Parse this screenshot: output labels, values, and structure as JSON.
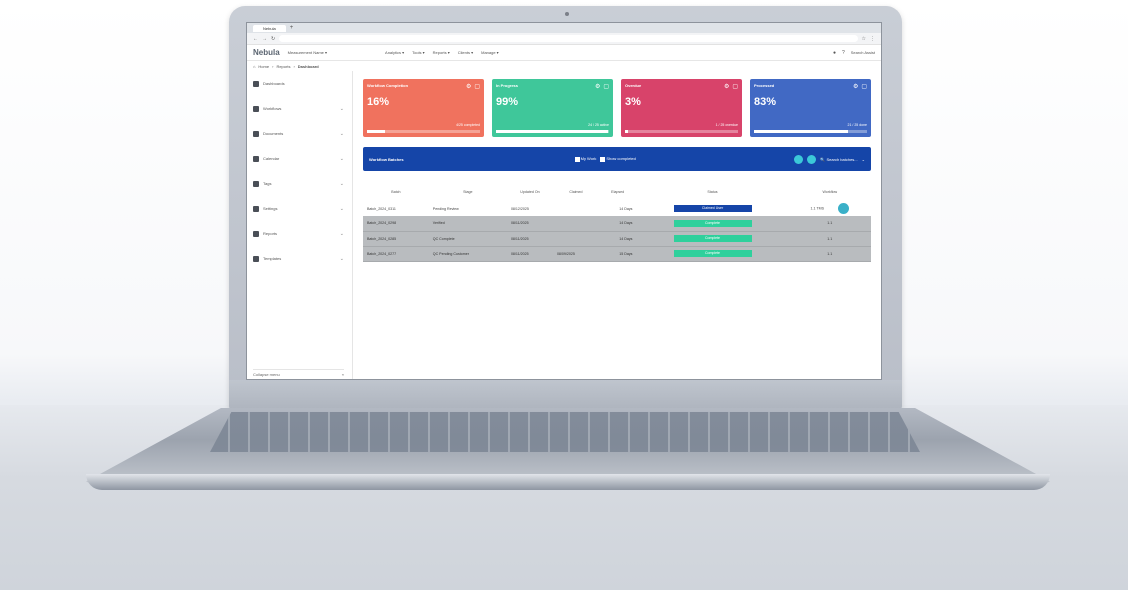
{
  "browser": {
    "tab_label": "Nebula",
    "tab_add": "+"
  },
  "app": {
    "logo": "Nebula",
    "workspace": "Measurement Name ▾",
    "menus": [
      "Analytics ▾",
      "Tools ▾",
      "Reports ▾",
      "Clients ▾",
      "Manage ▾"
    ],
    "user": "Search Assist"
  },
  "breadcrumb": [
    "Home",
    "Reports",
    "Dashboard"
  ],
  "sidebar": {
    "items": [
      {
        "label": "Dashboards"
      },
      {
        "label": "Workflows"
      },
      {
        "label": "Documents"
      },
      {
        "label": "Calendar"
      },
      {
        "label": "Tags"
      },
      {
        "label": "Settings"
      },
      {
        "label": "Reports"
      },
      {
        "label": "Templates"
      }
    ],
    "footer_left": "Collapse menu",
    "footer_right": "«"
  },
  "kpis": [
    {
      "title": "Workflow Completion",
      "value": "16%",
      "sub": "4/25 completed",
      "progress": 0.16,
      "color": "#f0725e"
    },
    {
      "title": "In Progress",
      "value": "99%",
      "sub": "24 / 25 active",
      "progress": 0.99,
      "color": "#3fc79a"
    },
    {
      "title": "Overdue",
      "value": "3%",
      "sub": "1 / 25 overdue",
      "progress": 0.03,
      "color": "#d8436a"
    },
    {
      "title": "Processed",
      "value": "83%",
      "sub": "21 / 25 done",
      "progress": 0.83,
      "color": "#4169c4"
    }
  ],
  "workflow_bar": {
    "title": "Workflow Batches",
    "check1": "My Work",
    "check2": "Show completed",
    "search": "Search batches..."
  },
  "table": {
    "headers": [
      "Batch",
      "Stage",
      "Updated On",
      "Claimed",
      "Elapsed",
      "Status",
      "Workflow"
    ],
    "rows": [
      {
        "batch": "Batch_2024_0311",
        "stage": "Pending Review",
        "updated": "08/12/2025",
        "claimed": "",
        "elapsed": "14 Days",
        "status": "Claimed User",
        "status_color": "#1545a8",
        "workflow": "1.1 TMS",
        "style": "first"
      },
      {
        "batch": "Batch_2024_0298",
        "stage": "Verified",
        "updated": "08/11/2025",
        "claimed": "",
        "elapsed": "14 Days",
        "status": "Complete",
        "status_color": "#2fd09c",
        "workflow": "1.1",
        "style": "grey"
      },
      {
        "batch": "Batch_2024_0285",
        "stage": "QC Complete",
        "updated": "08/11/2025",
        "claimed": "",
        "elapsed": "14 Days",
        "status": "Complete",
        "status_color": "#2fd09c",
        "workflow": "1.1",
        "style": "grey"
      },
      {
        "batch": "Batch_2024_0277",
        "stage": "QC Pending Customer",
        "updated": "08/11/2025",
        "claimed": "08/09/2025",
        "elapsed": "15 Days",
        "status": "Complete",
        "status_color": "#2fd09c",
        "workflow": "1.1",
        "style": "grey"
      }
    ]
  }
}
